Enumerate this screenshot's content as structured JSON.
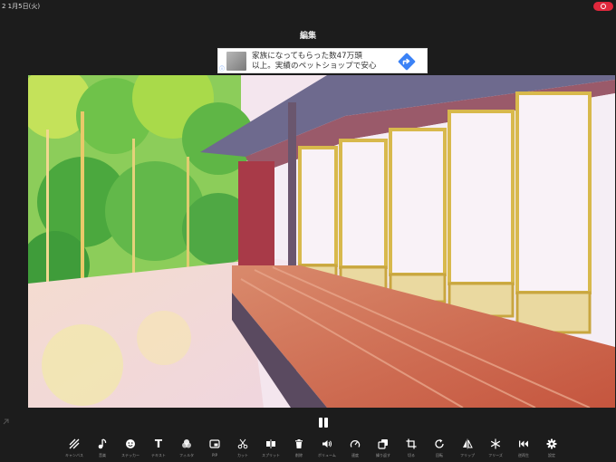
{
  "statusbar": {
    "time": "2 1月5日(火)",
    "recording_color": "#e0283c"
  },
  "header": {
    "title": "編集"
  },
  "ad": {
    "info_glyph": "ⓘ",
    "line1": "家族になってもらった数47万頭",
    "line2": "以上。実績のペットショップで安心",
    "arrow_color": "#3b82f6"
  },
  "player": {
    "state": "paused"
  },
  "toolbar": {
    "items": [
      {
        "label": "キャンバス",
        "icon": "canvas-icon"
      },
      {
        "label": "音楽",
        "icon": "music-icon"
      },
      {
        "label": "ステッカー",
        "icon": "sticker-icon"
      },
      {
        "label": "テキスト",
        "icon": "text-icon",
        "glyph": "T"
      },
      {
        "label": "フィルタ",
        "icon": "filter-icon"
      },
      {
        "label": "PIP",
        "icon": "pip-icon"
      },
      {
        "label": "カット",
        "icon": "scissors-icon"
      },
      {
        "label": "スプリット",
        "icon": "split-icon"
      },
      {
        "label": "削除",
        "icon": "trash-icon"
      },
      {
        "label": "ボリューム",
        "icon": "volume-icon"
      },
      {
        "label": "速度",
        "icon": "speed-icon"
      },
      {
        "label": "繰り返す",
        "icon": "duplicate-icon"
      },
      {
        "label": "切る",
        "icon": "crop-icon"
      },
      {
        "label": "回転",
        "icon": "rotate-icon"
      },
      {
        "label": "フリップ",
        "icon": "flip-icon"
      },
      {
        "label": "フリーズ",
        "icon": "freeze-icon"
      },
      {
        "label": "逆再生",
        "icon": "reverse-icon"
      },
      {
        "label": "設定",
        "icon": "gear-icon"
      }
    ]
  }
}
